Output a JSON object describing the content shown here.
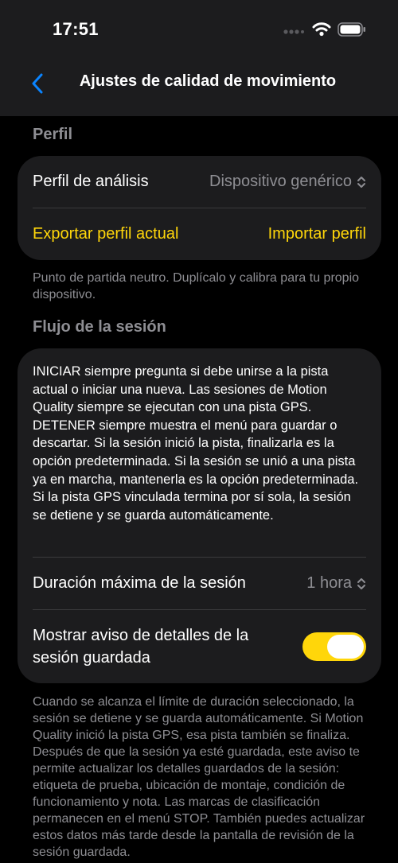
{
  "status_bar": {
    "time": "17:51"
  },
  "nav": {
    "title": "Ajustes de calidad de movimiento"
  },
  "profile_section": {
    "header": "Perfil",
    "analysis_profile_label": "Perfil de análisis",
    "analysis_profile_value": "Dispositivo genérico",
    "export_label": "Exportar perfil actual",
    "import_label": "Importar perfil",
    "footer": "Punto de partida neutro. Duplícalo y calibra para tu propio dispositivo."
  },
  "session_section": {
    "header": "Flujo de la sesión",
    "description": "INICIAR siempre pregunta si debe unirse a la pista actual o iniciar una nueva. Las sesiones de Motion Quality siempre se ejecutan con una pista GPS. DETENER siempre muestra el menú para guardar o descartar. Si la sesión inició la pista, finalizarla es la opción predeterminada. Si la sesión se unió a una pista ya en marcha, mantenerla es la opción predeterminada. Si la pista GPS vinculada termina por sí sola, la sesión se detiene y se guarda automáticamente.",
    "max_duration_label": "Duración máxima de la sesión",
    "max_duration_value": "1 hora",
    "show_notice_label": "Mostrar aviso de detalles de la sesión guardada",
    "show_notice_enabled": true,
    "footer": "Cuando se alcanza el límite de duración seleccionado, la sesión se detiene y se guarda automáticamente. Si Motion Quality inició la pista GPS, esa pista también se finaliza. Después de que la sesión ya esté guardada, este aviso te permite actualizar los detalles guardados de la sesión: etiqueta de prueba, ubicación de montaje, condición de funcionamiento y nota. Las marcas de clasificación permanecen en el menú STOP. También puedes actualizar estos datos más tarde desde la pantalla de revisión de la sesión guardada."
  },
  "colors": {
    "accent": "#ffd60a",
    "back_arrow": "#0a84ff",
    "card_background": "#1c1c1e",
    "secondary_text": "#8e8e93"
  },
  "icons": {
    "back": "chevron-left-icon",
    "picker": "chevron-up-down-icon",
    "signal": "cellular-signal-icon",
    "wifi": "wifi-icon",
    "battery": "battery-icon"
  }
}
